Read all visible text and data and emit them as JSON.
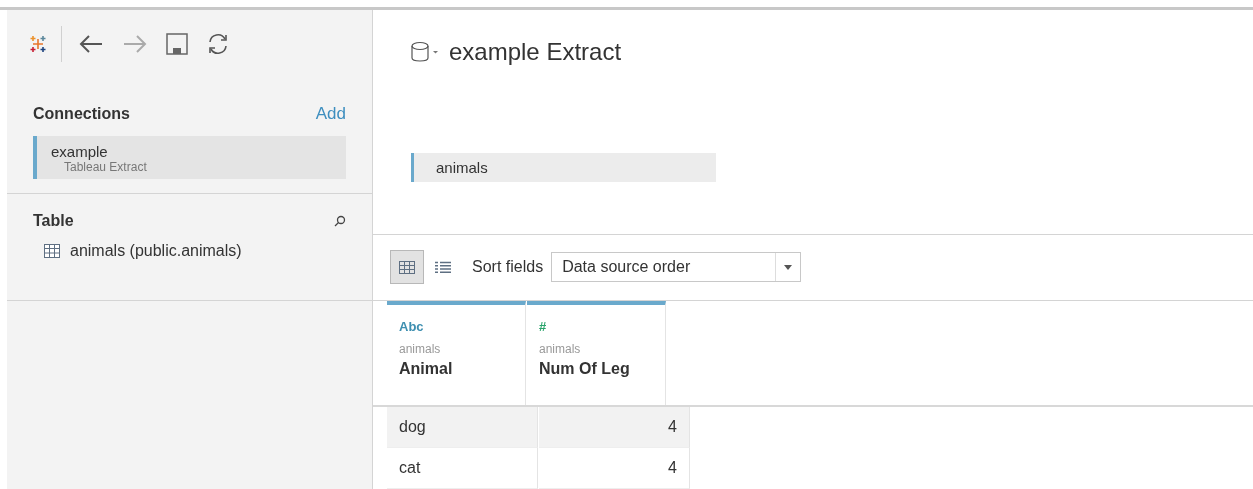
{
  "sidebar": {
    "connections": {
      "title": "Connections",
      "add": "Add",
      "items": [
        {
          "name": "example",
          "type": "Tableau Extract",
          "selected": true
        }
      ]
    },
    "table": {
      "title": "Table",
      "items": [
        {
          "label": "animals (public.animals)"
        }
      ]
    }
  },
  "main": {
    "title": "example Extract",
    "canvas_tables": [
      {
        "label": "animals"
      }
    ],
    "toolbar": {
      "views": [
        {
          "kind": "grid",
          "selected": true
        },
        {
          "kind": "list",
          "selected": false
        }
      ],
      "sort_label": "Sort fields",
      "sort_value": "Data source order"
    },
    "columns": [
      {
        "type": "Abc",
        "color": "#3e8fb0",
        "source": "animals",
        "name": "Animal",
        "kind": "text"
      },
      {
        "type": "#",
        "color": "#2aa46b",
        "source": "animals",
        "name": "Num Of Leg",
        "kind": "number"
      }
    ],
    "rows": [
      {
        "selected": true,
        "cells": [
          "dog",
          "4"
        ]
      },
      {
        "selected": false,
        "cells": [
          "cat",
          "4"
        ]
      }
    ]
  }
}
